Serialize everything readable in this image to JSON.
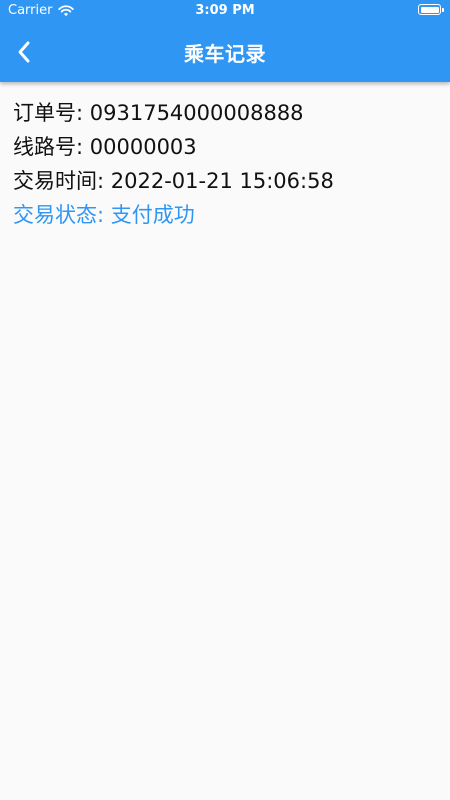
{
  "status_bar": {
    "carrier": "Carrier",
    "time": "3:09 PM",
    "wifi_icon": "wifi-icon",
    "battery_icon": "battery-icon"
  },
  "app_bar": {
    "title": "乘车记录",
    "back_icon": "chevron-left-icon",
    "color": "#2f96f3"
  },
  "record": {
    "order_label": "订单号: ",
    "order_value": "0931754000008888",
    "route_label": "线路号: ",
    "route_value": "00000003",
    "time_label": "交易时间: ",
    "time_value": "2022-01-21 15:06:58",
    "status_label": "交易状态: ",
    "status_value": "支付成功",
    "status_color": "#2f96f3"
  }
}
